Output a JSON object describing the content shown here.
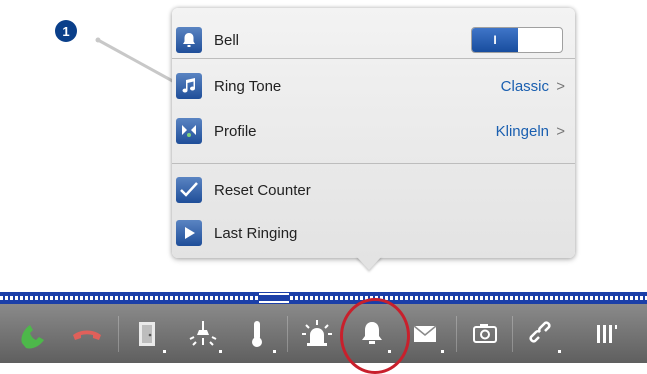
{
  "callout": {
    "number": "1"
  },
  "menu": {
    "bell": {
      "label": "Bell",
      "toggle_text": "I"
    },
    "ring_tone": {
      "label": "Ring Tone",
      "value": "Classic",
      "chevron": ">"
    },
    "profile": {
      "label": "Profile",
      "value": "Klingeln",
      "chevron": ">"
    },
    "reset_counter": {
      "label": "Reset Counter"
    },
    "last_ringing": {
      "label": "Last Ringing"
    }
  },
  "colors": {
    "accent_blue": "#1a5fb0",
    "toolbar_gray": "#6f6f6f",
    "phone_green": "#4db84a",
    "phone_red": "#e0605a",
    "highlight_red": "#c8202c"
  },
  "toolbar": {
    "icons": [
      "phone-accept-icon",
      "phone-hangup-icon",
      "door-icon",
      "light-icon",
      "thermometer-icon",
      "alarm-light-icon",
      "bell-icon",
      "mail-icon",
      "camera-icon",
      "link-icon",
      "barrier-icon"
    ]
  }
}
